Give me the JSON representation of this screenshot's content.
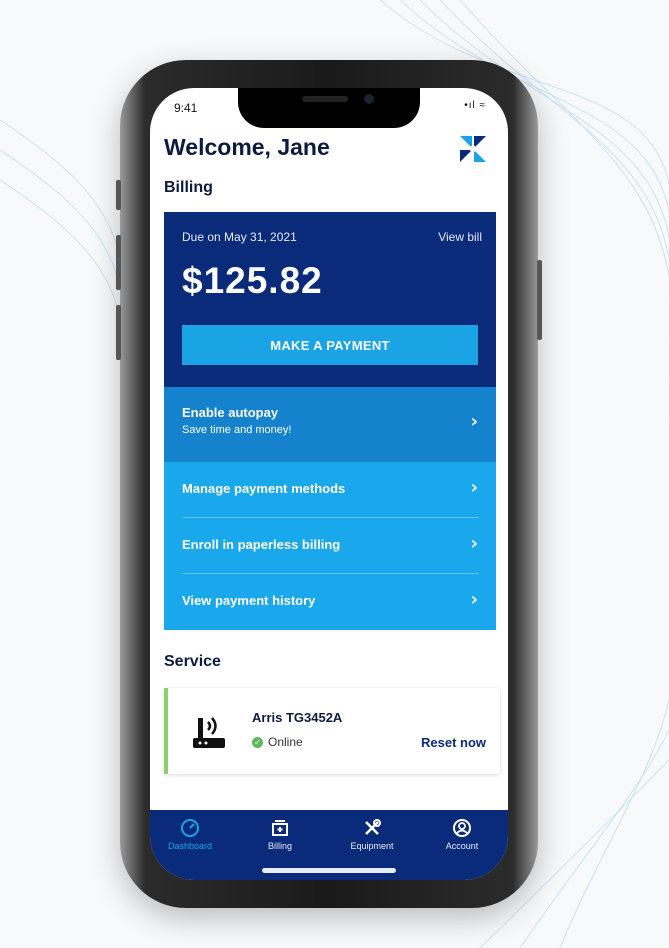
{
  "status_bar": {
    "time": "9:41",
    "signal": "•ıl ≈"
  },
  "header": {
    "welcome": "Welcome, Jane",
    "logo": "brand-logo-icon"
  },
  "billing": {
    "section_title": "Billing",
    "due_text": "Due on May 31, 2021",
    "view_bill": "View bill",
    "amount": "$125.82",
    "pay_button": "MAKE A PAYMENT",
    "autopay_title": "Enable autopay",
    "autopay_subtitle": "Save time and money!",
    "options": [
      {
        "label": "Manage payment methods"
      },
      {
        "label": "Enroll in paperless billing"
      },
      {
        "label": "View payment history"
      }
    ]
  },
  "service": {
    "section_title": "Service",
    "device_name": "Arris TG3452A",
    "status": "Online",
    "reset": "Reset now"
  },
  "tabs": [
    {
      "label": "Dashboard",
      "icon": "gauge-icon",
      "active": true
    },
    {
      "label": "Billing",
      "icon": "bill-icon",
      "active": false
    },
    {
      "label": "Equipment",
      "icon": "tools-icon",
      "active": false
    },
    {
      "label": "Account",
      "icon": "user-icon",
      "active": false
    }
  ],
  "colors": {
    "navy": "#0a2a7a",
    "blue": "#1482cc",
    "light_blue": "#1aa8ec",
    "online_green": "#5cb85c"
  }
}
